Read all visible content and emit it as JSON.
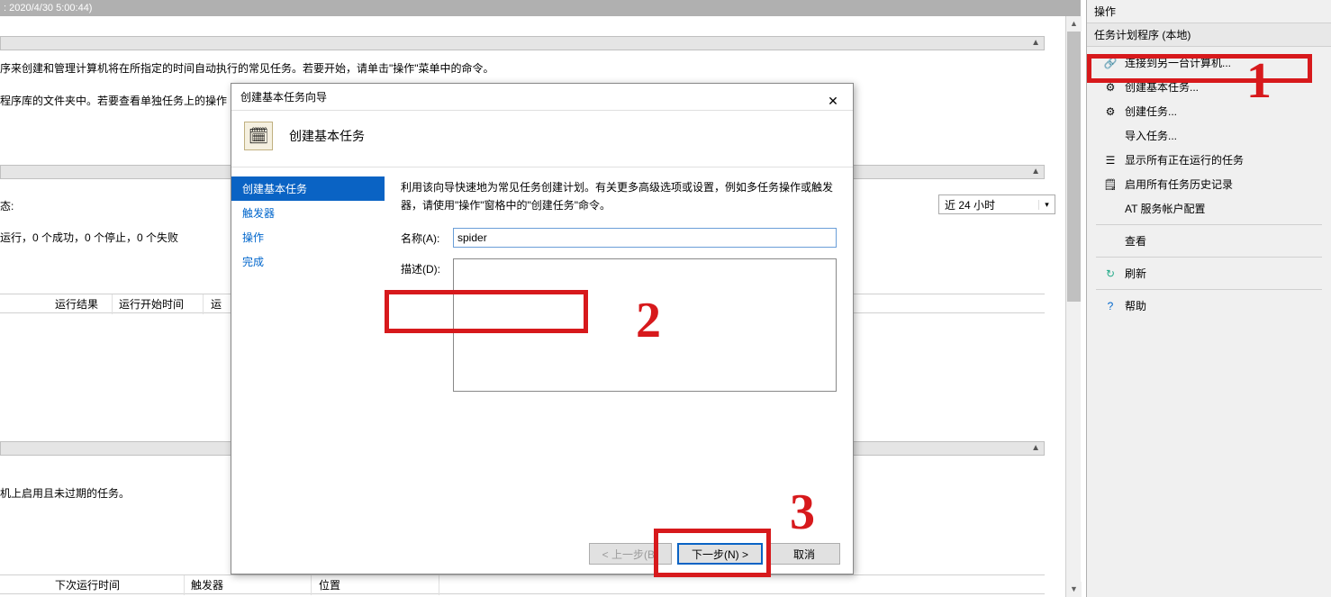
{
  "titlebar": ": 2020/4/30 5:00:44)",
  "bg": {
    "desc1a": "序来创建和管理计算机将在所指定的时间自动执行的常见任务。若要开始，请单击\"操作\"菜单中的命令。",
    "desc1b": "程序库的文件夹中。若要查看单独任务上的操作",
    "status_label": "态:",
    "stats": "运行，0 个成功，0 个停止，0 个失败",
    "dropdown": "近 24 小时",
    "active_header": "机上启用且未过期的任务。",
    "cols1": {
      "result": "运行结果",
      "start": "运行开始时间",
      "run": "运"
    },
    "cols2": {
      "next": "下次运行时间",
      "trigger": "触发器",
      "loc": "位置"
    }
  },
  "right": {
    "title": "操作",
    "sub": "任务计划程序 (本地)",
    "items": [
      {
        "icon": "link",
        "label": "连接到另一台计算机..."
      },
      {
        "icon": "gear",
        "label": "创建基本任务..."
      },
      {
        "icon": "gear",
        "label": "创建任务..."
      },
      {
        "icon": "",
        "label": "导入任务..."
      },
      {
        "icon": "list",
        "label": "显示所有正在运行的任务"
      },
      {
        "icon": "log",
        "label": "启用所有任务历史记录"
      },
      {
        "icon": "",
        "label": "AT 服务帐户配置"
      },
      {
        "icon": "",
        "label": "查看"
      },
      {
        "icon": "refresh",
        "label": "刷新"
      },
      {
        "icon": "help",
        "label": "帮助"
      }
    ]
  },
  "dialog": {
    "title": "创建基本任务向导",
    "header": "创建基本任务",
    "steps": [
      "创建基本任务",
      "触发器",
      "操作",
      "完成"
    ],
    "desc": "利用该向导快速地为常见任务创建计划。有关更多高级选项或设置，例如多任务操作或触发器，请使用\"操作\"窗格中的\"创建任务\"命令。",
    "name_label": "名称(A):",
    "name_value": "spider",
    "desc_label": "描述(D):",
    "desc_value": "",
    "btn_back": "< 上一步(B)",
    "btn_next": "下一步(N) >",
    "btn_cancel": "取消"
  },
  "ann": {
    "n1": "1",
    "n2": "2",
    "n3": "3"
  }
}
